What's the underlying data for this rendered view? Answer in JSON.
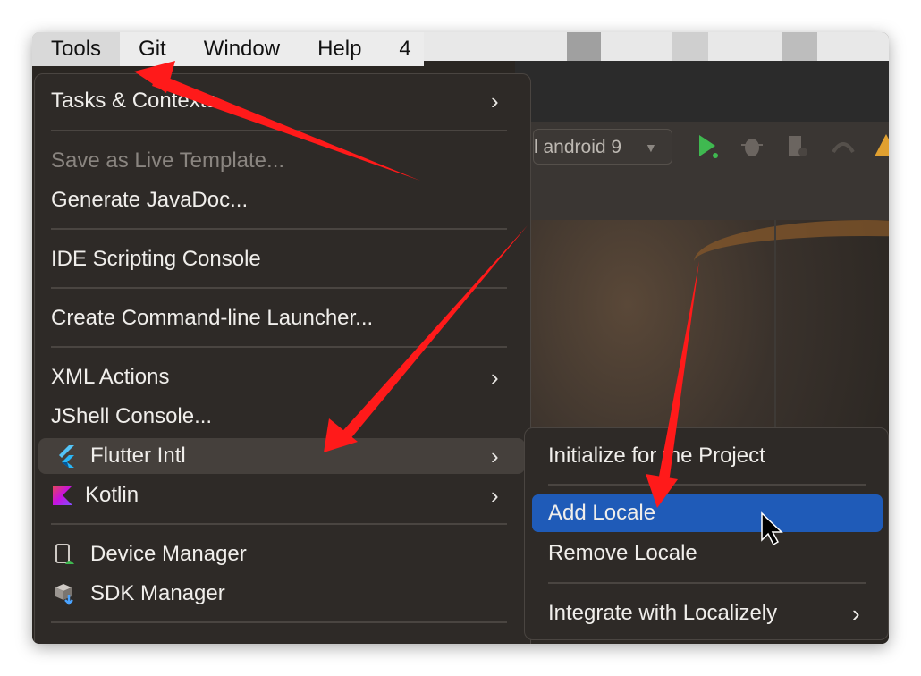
{
  "menubar": {
    "items": [
      "Tools",
      "Git",
      "Window",
      "Help",
      "4"
    ]
  },
  "ide": {
    "device_selector": "l android 9"
  },
  "tools_menu": {
    "items": [
      {
        "label": "Tasks & Contexts",
        "submenu": true
      },
      {
        "label": "Save as Live Template...",
        "disabled": true
      },
      {
        "label": "Generate JavaDoc..."
      },
      {
        "label": "IDE Scripting Console"
      },
      {
        "label": "Create Command-line Launcher..."
      },
      {
        "label": "XML Actions",
        "submenu": true
      },
      {
        "label": "JShell Console..."
      },
      {
        "label": "Flutter Intl",
        "submenu": true,
        "icon": "flutter-icon",
        "highlighted": true
      },
      {
        "label": "Kotlin",
        "submenu": true,
        "icon": "kotlin-icon"
      },
      {
        "label": "Device Manager",
        "icon": "device-manager-icon"
      },
      {
        "label": "SDK Manager",
        "icon": "sdk-manager-icon"
      }
    ]
  },
  "flutter_intl_submenu": {
    "items": [
      {
        "label": "Initialize for the Project"
      },
      {
        "label": "Add Locale",
        "selected": true
      },
      {
        "label": "Remove Locale"
      },
      {
        "label": "Integrate with Localizely",
        "submenu": true
      }
    ]
  },
  "colors": {
    "menu_bg": "#2e2a27",
    "selected_bg": "#1f5bb8",
    "highlight_bg": "#45403c",
    "annotation_arrow": "#ff1a1a"
  },
  "chevron": "›"
}
